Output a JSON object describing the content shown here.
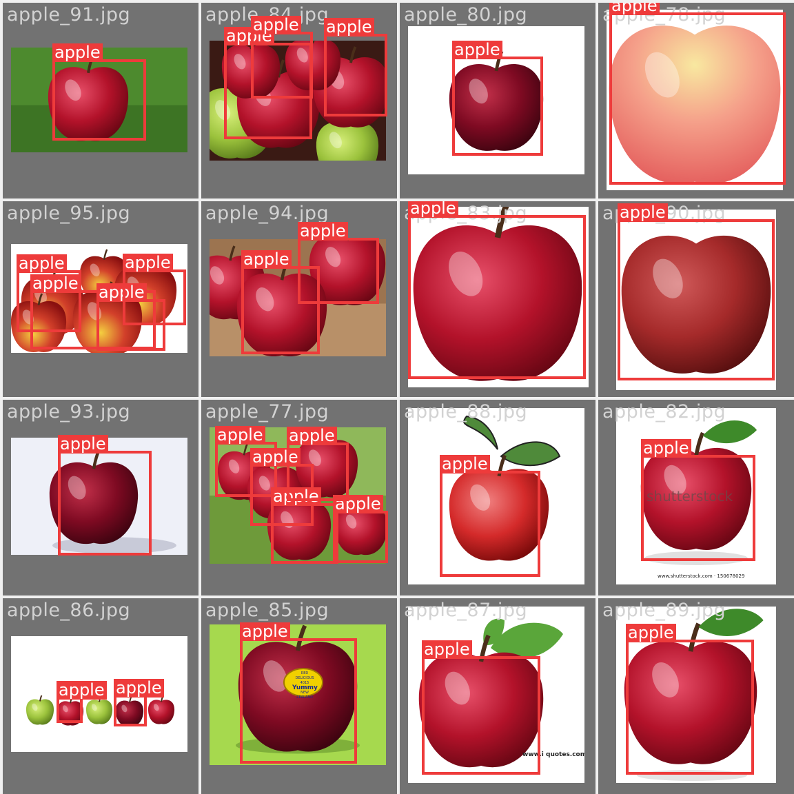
{
  "detection_label": "apple",
  "colors": {
    "box": "#ee3b3b",
    "tile_background": "#727272",
    "filename_text": "#d2d2d2"
  },
  "tiles": [
    {
      "filename": "apple_91.jpg",
      "scene": "single red apple on green grass"
    },
    {
      "filename": "apple_84.jpg",
      "scene": "pile of red and green apples"
    },
    {
      "filename": "apple_80.jpg",
      "scene": "dark red apple on white"
    },
    {
      "filename": "apple_78.jpg",
      "scene": "pink-yellow apple close-up"
    },
    {
      "filename": "apple_95.jpg",
      "scene": "group of red-yellow apples"
    },
    {
      "filename": "apple_94.jpg",
      "scene": "red apples on wooden surface"
    },
    {
      "filename": "apple_83.jpg",
      "scene": "large red apple close-up"
    },
    {
      "filename": "apple_90.jpg",
      "scene": "red apple on white"
    },
    {
      "filename": "apple_93.jpg",
      "scene": "dark red apple on white"
    },
    {
      "filename": "apple_77.jpg",
      "scene": "red apples on tree branches"
    },
    {
      "filename": "apple_88.jpg",
      "scene": "drawn red apple with leaves"
    },
    {
      "filename": "apple_82.jpg",
      "scene": "red apple with leaf",
      "watermark": "shutterstock",
      "caption": "www.shutterstock.com · 150678029"
    },
    {
      "filename": "apple_86.jpg",
      "scene": "row of five apples, green and red"
    },
    {
      "filename": "apple_85.jpg",
      "scene": "red apple with sticker on green background",
      "sticker": [
        "RED DELICIOUS",
        "4015",
        "Yummy",
        "NEW ZEALAND"
      ]
    },
    {
      "filename": "apple_87.jpg",
      "scene": "red apple with leaves",
      "caption": "www.i  quotes.com"
    },
    {
      "filename": "apple_89.jpg",
      "scene": "red apple with leaf"
    }
  ]
}
